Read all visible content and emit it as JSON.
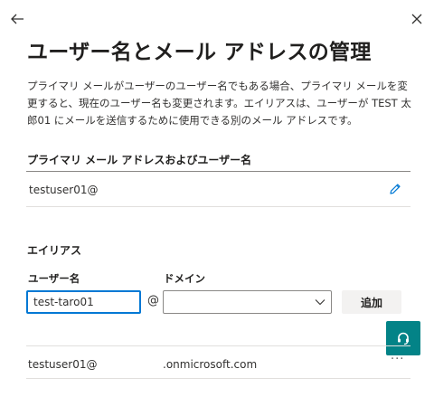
{
  "nav": {
    "back_icon": "arrow-left-icon",
    "close_icon": "close-icon"
  },
  "page": {
    "title": "ユーザー名とメール アドレスの管理",
    "description": "プライマリ メールがユーザーのユーザー名でもある場合、プライマリ メールを変更すると、現在のユーザー名も変更されます。エイリアスは、ユーザーが TEST 太郎01 にメールを送信するために使用できる別のメール アドレスです。"
  },
  "primary": {
    "section_label": "プライマリ メール アドレスおよびユーザー名",
    "value": "testuser01@",
    "edit_icon": "pencil-icon"
  },
  "alias": {
    "section_label": "エイリアス",
    "username_label": "ユーザー名",
    "domain_label": "ドメイン",
    "username_value": "test-taro01",
    "at_sign": "@",
    "domain_value": "",
    "add_button": "追加",
    "rows": [
      {
        "local_part": "testuser01@",
        "domain": ".onmicrosoft.com",
        "more": "···"
      }
    ]
  },
  "colors": {
    "accent": "#0078d4",
    "fab": "#038387",
    "button_bg": "#f3f2f1",
    "divider": "#8a8886"
  },
  "fab": {
    "icon": "headset-icon"
  }
}
